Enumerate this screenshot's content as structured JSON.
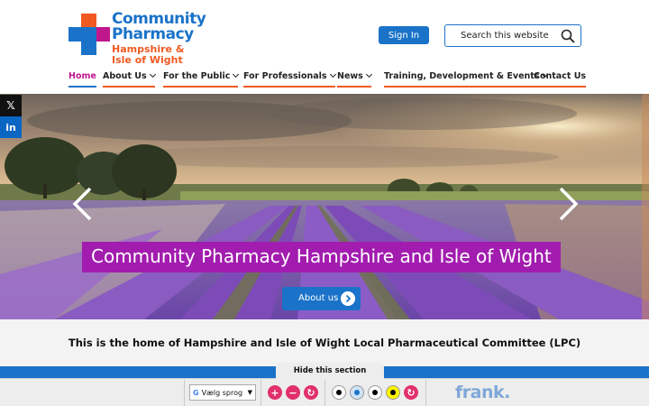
{
  "brand": {
    "line1": "Community",
    "line2": "Pharmacy",
    "line3": "Hampshire &",
    "line4": "Isle of Wight"
  },
  "header": {
    "signin_label": "Sign In",
    "search_placeholder": "Search this website"
  },
  "nav": {
    "items": [
      {
        "label": "Home",
        "dropdown": false,
        "active": true
      },
      {
        "label": "About Us",
        "dropdown": true
      },
      {
        "label": "For the Public",
        "dropdown": true
      },
      {
        "label": "For Professionals",
        "dropdown": true
      },
      {
        "label": "News",
        "dropdown": true
      },
      {
        "label": "Training, Development & Events",
        "dropdown": true
      },
      {
        "label": "Contact Us",
        "dropdown": false
      }
    ]
  },
  "social": {
    "x_label": "𝕏",
    "linkedin_label": "in"
  },
  "hero": {
    "title": "Community Pharmacy Hampshire and Isle of Wight",
    "button_label": "About us"
  },
  "intro": {
    "text": "This is the home of Hampshire and Isle of Wight Local Pharmaceutical Committee (LPC)"
  },
  "accessibility": {
    "hide_label": "Hide this section",
    "language_label": "Vælg sprog",
    "language_arrow": "▼",
    "google_mark": "G",
    "increase_symbol": "+",
    "decrease_symbol": "−",
    "reset_symbol": "↻",
    "themes": [
      {
        "bg": "#ffffff",
        "dot": "#000000"
      },
      {
        "bg": "#cfe3f7",
        "dot": "#1a73c9"
      },
      {
        "bg": "#ffffff",
        "dot": "#000000"
      },
      {
        "bg": "#fff200",
        "dot": "#000000"
      }
    ],
    "partner_logo": "frank."
  },
  "colors": {
    "primary_blue": "#1a73c9",
    "accent_orange": "#f05a22",
    "accent_magenta": "#c0168c",
    "hero_title_bg": "#a21caf"
  }
}
